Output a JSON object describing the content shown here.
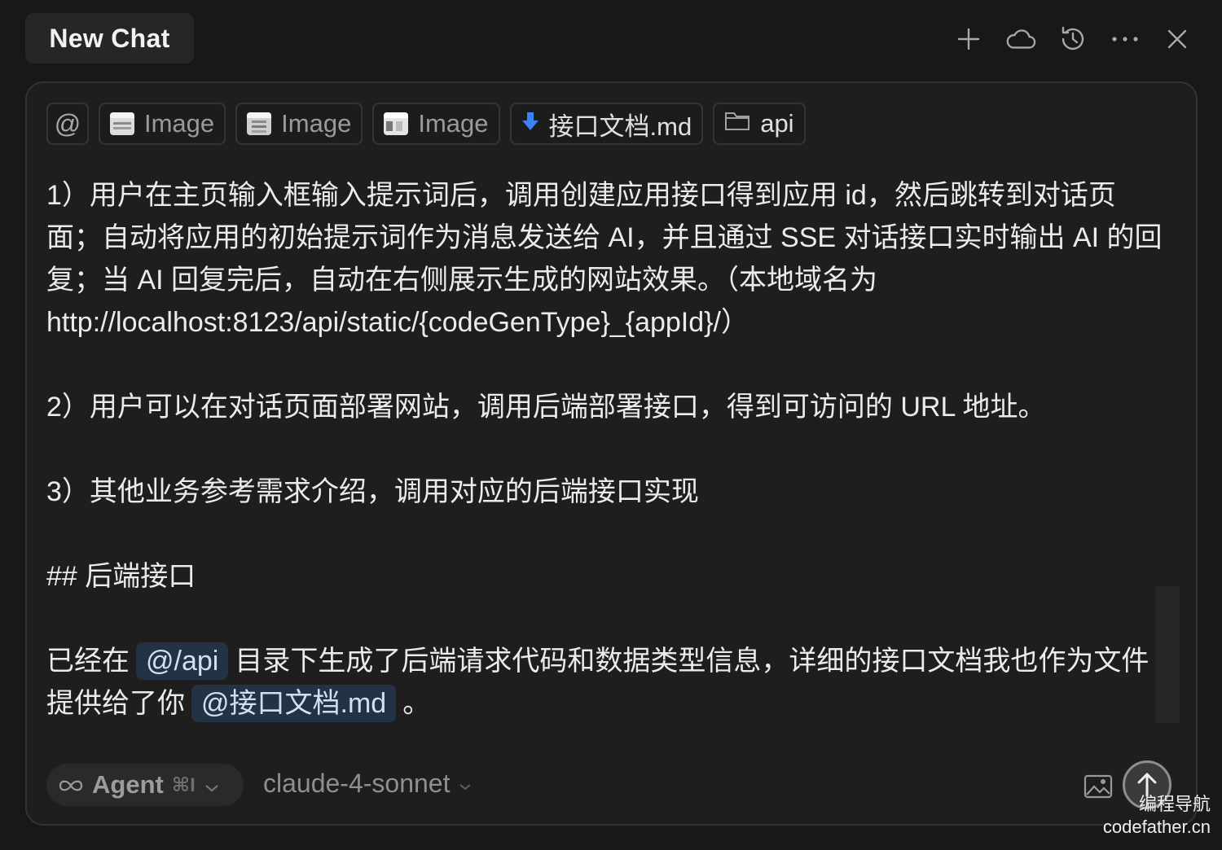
{
  "header": {
    "tab_title": "New Chat",
    "icons": [
      "plus-icon",
      "cloud-icon",
      "history-icon",
      "more-icon",
      "close-icon"
    ]
  },
  "context_chips": [
    {
      "type": "at",
      "label": "@"
    },
    {
      "type": "image",
      "label": "Image"
    },
    {
      "type": "image",
      "label": "Image"
    },
    {
      "type": "image",
      "label": "Image"
    },
    {
      "type": "file",
      "label": "接口文档.md"
    },
    {
      "type": "folder",
      "label": "api"
    }
  ],
  "message": {
    "line1": "1）用户在主页输入框输入提示词后，调用创建应用接口得到应用 id，然后跳转到对话页",
    "line2": "面；自动将应用的初始提示词作为消息发送给 AI，并且通过 SSE 对话接口实时输出 AI 的回",
    "line3": "复；当 AI 回复完后，自动在右侧展示生成的网站效果。（本地域名为",
    "line4": "http://localhost:8123/api/static/{codeGenType}_{appId}/）",
    "para2": "2）用户可以在对话页面部署网站，调用后端部署接口，得到可访问的 URL 地址。",
    "para3": "3）其他业务参考需求介绍，调用对应的后端接口实现",
    "heading": "## 后端接口",
    "p4_before": "已经在",
    "mention_api": "@/api",
    "p4_middle": "目录下生成了后端请求代码和数据类型信息，详细的接口文档我也作为文件",
    "p4_line2_before": "提供给了你",
    "mention_doc": "@接口文档.md",
    "p4_end": "。"
  },
  "footer": {
    "agent_label": "Agent",
    "agent_shortcut": "⌘I",
    "model": "claude-4-sonnet"
  },
  "watermark": {
    "line1": "编程导航",
    "line2": "codefather.cn"
  },
  "colors": {
    "background": "#181818",
    "composer": "#1e1e1e",
    "mention_bg": "#243246",
    "mention_text": "#cfe0f5",
    "file_icon": "#3b82f6"
  }
}
